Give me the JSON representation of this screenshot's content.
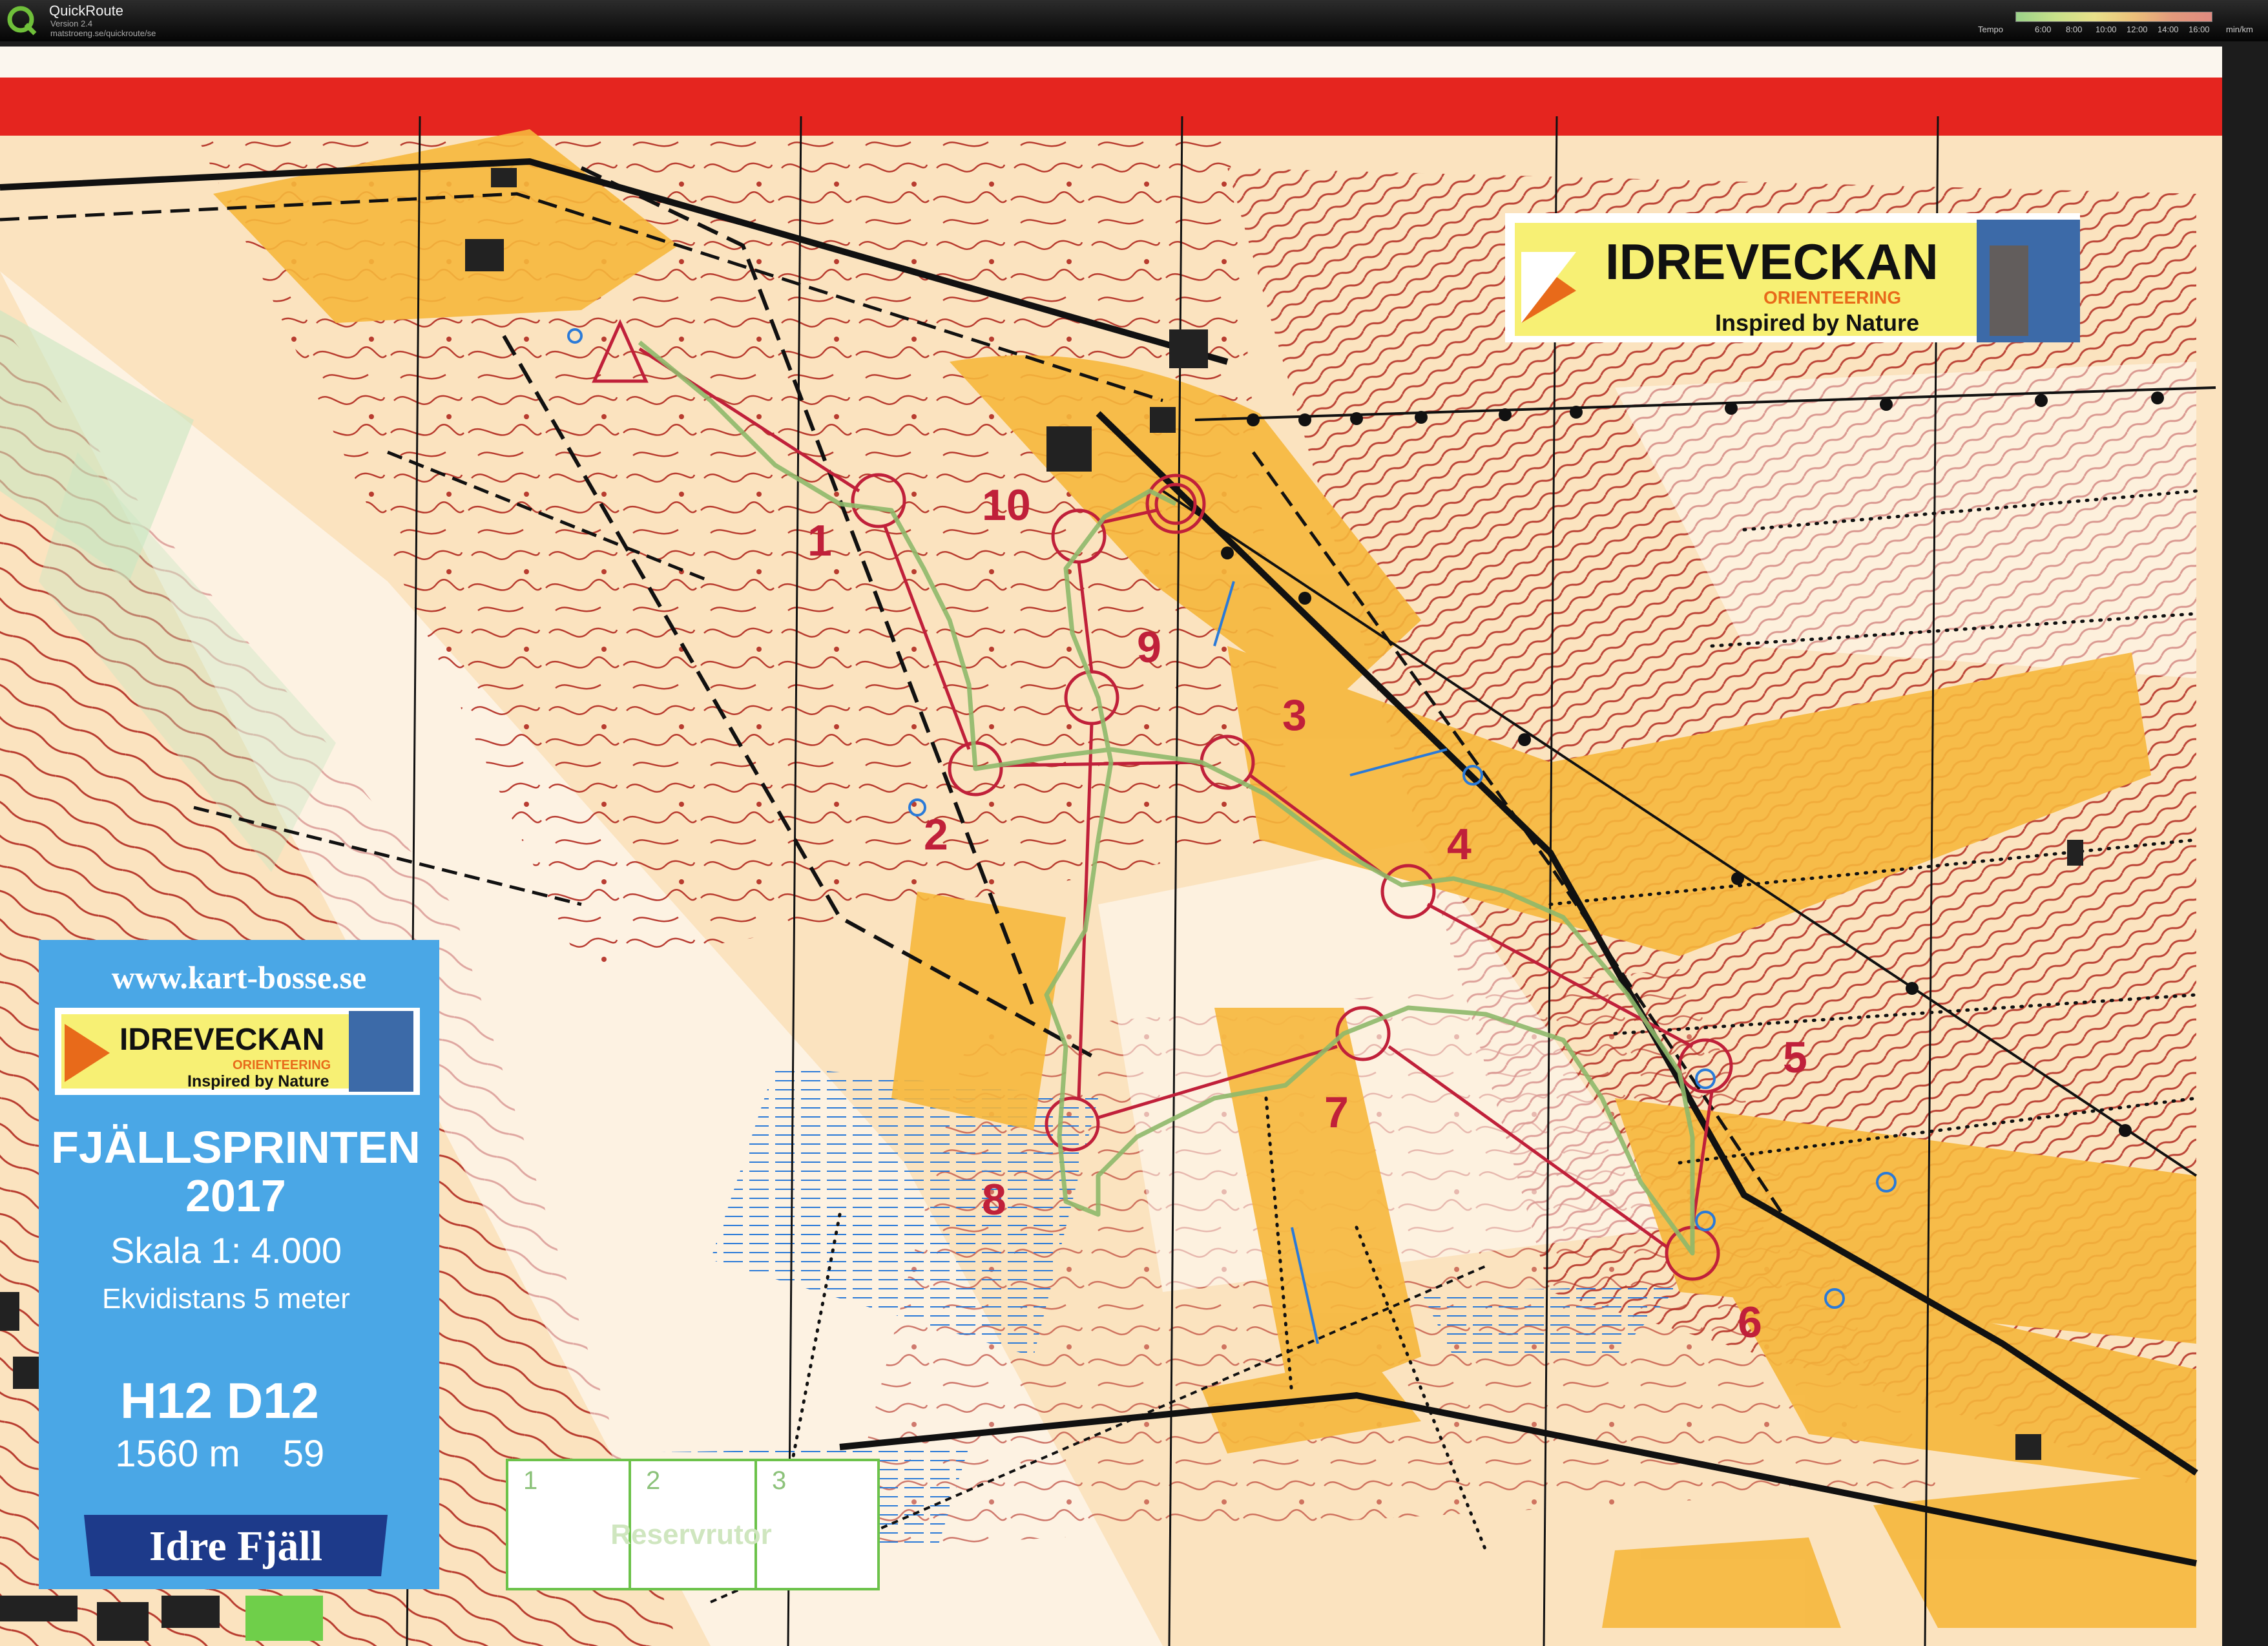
{
  "app": {
    "title": "QuickRoute",
    "version": "Version 2.4",
    "url": "matstroeng.se/quickroute/se",
    "icon": "quickroute-q-icon"
  },
  "tempo": {
    "label": "Tempo",
    "ticks": [
      "6:00",
      "8:00",
      "10:00",
      "12:00",
      "14:00",
      "16:00"
    ],
    "unit": "min/km"
  },
  "map": {
    "website": "www.kart-bosse.se",
    "logo_title": "IDREVECKAN",
    "logo_sub": "ORIENTEERING",
    "logo_slogan": "Inspired by Nature",
    "event": "FJÄLLSPRINTEN",
    "year": "2017",
    "scale": "Skala 1: 4.000",
    "contour": "Ekvidistans 5 meter",
    "classes": "H12 D12",
    "length": "1560 m",
    "climb": "59",
    "sponsor": "Idre Fjäll",
    "spare_label": "Reservrutor",
    "spare_boxes": [
      "1",
      "2",
      "3"
    ],
    "controls": [
      "1",
      "2",
      "3",
      "4",
      "5",
      "6",
      "7",
      "8",
      "9",
      "10"
    ]
  },
  "colors": {
    "map_red": "#b1291f",
    "control_purple": "#c0203a",
    "route_green": "#8eb86a",
    "open_yellow": "#f6b73c",
    "panel_blue": "#4aa7e6"
  }
}
